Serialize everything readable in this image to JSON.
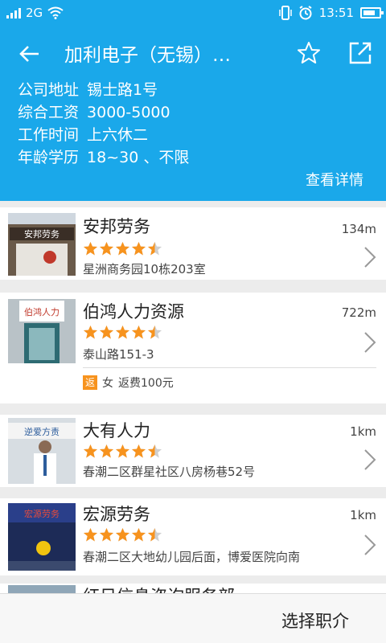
{
  "status": {
    "network": "2G",
    "time": "13:51"
  },
  "header": {
    "title": "加利电子（无锡）…",
    "info": [
      {
        "label": "公司地址",
        "value": "锡士路1号"
      },
      {
        "label": "综合工资",
        "value": "3000-5000"
      },
      {
        "label": "工作时间",
        "value": "上六休二"
      },
      {
        "label": "年龄学历",
        "value": "18~30 、不限"
      }
    ],
    "detail_link": "查看详情"
  },
  "agencies": [
    {
      "name": "安邦劳务",
      "rating": 4.5,
      "address": "星洲商务园10栋203室",
      "distance": "134m",
      "sign": "安邦劳务"
    },
    {
      "name": "伯鸿人力资源",
      "rating": 4.5,
      "address": "泰山路151-3",
      "distance": "722m",
      "badge": "返",
      "gender": "女",
      "rebate": "返费100元",
      "sign": "伯鸿人力"
    },
    {
      "name": "大有人力",
      "rating": 4.5,
      "address": "春潮二区群星社区八房杨巷52号",
      "distance": "1km",
      "sign": "逆爱方责"
    },
    {
      "name": "宏源劳务",
      "rating": 4.5,
      "address": "春潮二区大地幼儿园后面，博爱医院向南",
      "distance": "1km",
      "sign": "宏源劳务"
    }
  ],
  "peek_text": "红日信息咨询服务部",
  "bottom": {
    "choose_label": "选择职介"
  },
  "colors": {
    "accent": "#1aa8ea",
    "star": "#f7931e"
  }
}
